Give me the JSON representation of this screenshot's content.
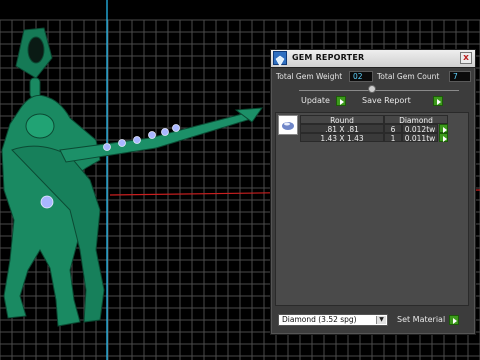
{
  "window": {
    "title": "GEM REPORTER",
    "close_label": "x"
  },
  "stats": {
    "total_weight_label": "Total Gem Weight",
    "total_weight_value": "02",
    "total_count_label": "Total Gem Count",
    "total_count_value": "7"
  },
  "actions": {
    "update_label": "Update",
    "save_report_label": "Save Report"
  },
  "table": {
    "headers": [
      "Round",
      "Diamond"
    ],
    "rows": [
      {
        "size": ".81 X .81",
        "count": "6",
        "weight": "0.012tw"
      },
      {
        "size": "1.43 X 1.43",
        "count": "1",
        "weight": "0.011tw"
      }
    ]
  },
  "material": {
    "selected": "Diamond     (3.52 spg)",
    "set_label": "Set Material"
  },
  "colors": {
    "accent_green": "#3d9a1c",
    "value_cyan": "#5fd3ff",
    "model_green": "#1a8a62"
  },
  "icons": {
    "title": "gem-reporter-icon",
    "go": "green-arrow-icon"
  }
}
